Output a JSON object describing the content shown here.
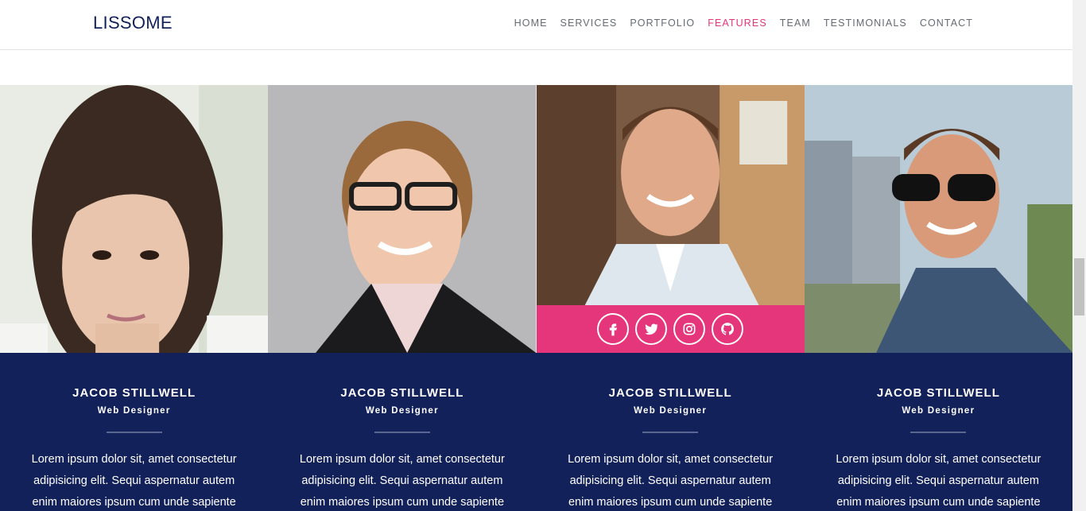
{
  "brand": "LISSOME",
  "nav": {
    "items": [
      "HOME",
      "SERVICES",
      "PORTFOLIO",
      "FEATURES",
      "TEAM",
      "TESTIMONIALS",
      "CONTACT"
    ],
    "active": "FEATURES"
  },
  "colors": {
    "navy": "#13215a",
    "accent": "#e5357b"
  },
  "team": [
    {
      "name": "JACOB STILLWELL",
      "role": "Web Designer",
      "bio": "Lorem ipsum dolor sit, amet consectetur adipisicing elit. Sequi aspernatur autem enim maiores ipsum cum unde sapiente"
    },
    {
      "name": "JACOB STILLWELL",
      "role": "Web Designer",
      "bio": "Lorem ipsum dolor sit, amet consectetur adipisicing elit. Sequi aspernatur autem enim maiores ipsum cum unde sapiente"
    },
    {
      "name": "JACOB STILLWELL",
      "role": "Web Designer",
      "bio": "Lorem ipsum dolor sit, amet consectetur adipisicing elit. Sequi aspernatur autem enim maiores ipsum cum unde sapiente"
    },
    {
      "name": "JACOB STILLWELL",
      "role": "Web Designer",
      "bio": "Lorem ipsum dolor sit, amet consectetur adipisicing elit. Sequi aspernatur autem enim maiores ipsum cum unde sapiente"
    }
  ],
  "social_icons": [
    "facebook-icon",
    "twitter-icon",
    "instagram-icon",
    "github-icon"
  ]
}
